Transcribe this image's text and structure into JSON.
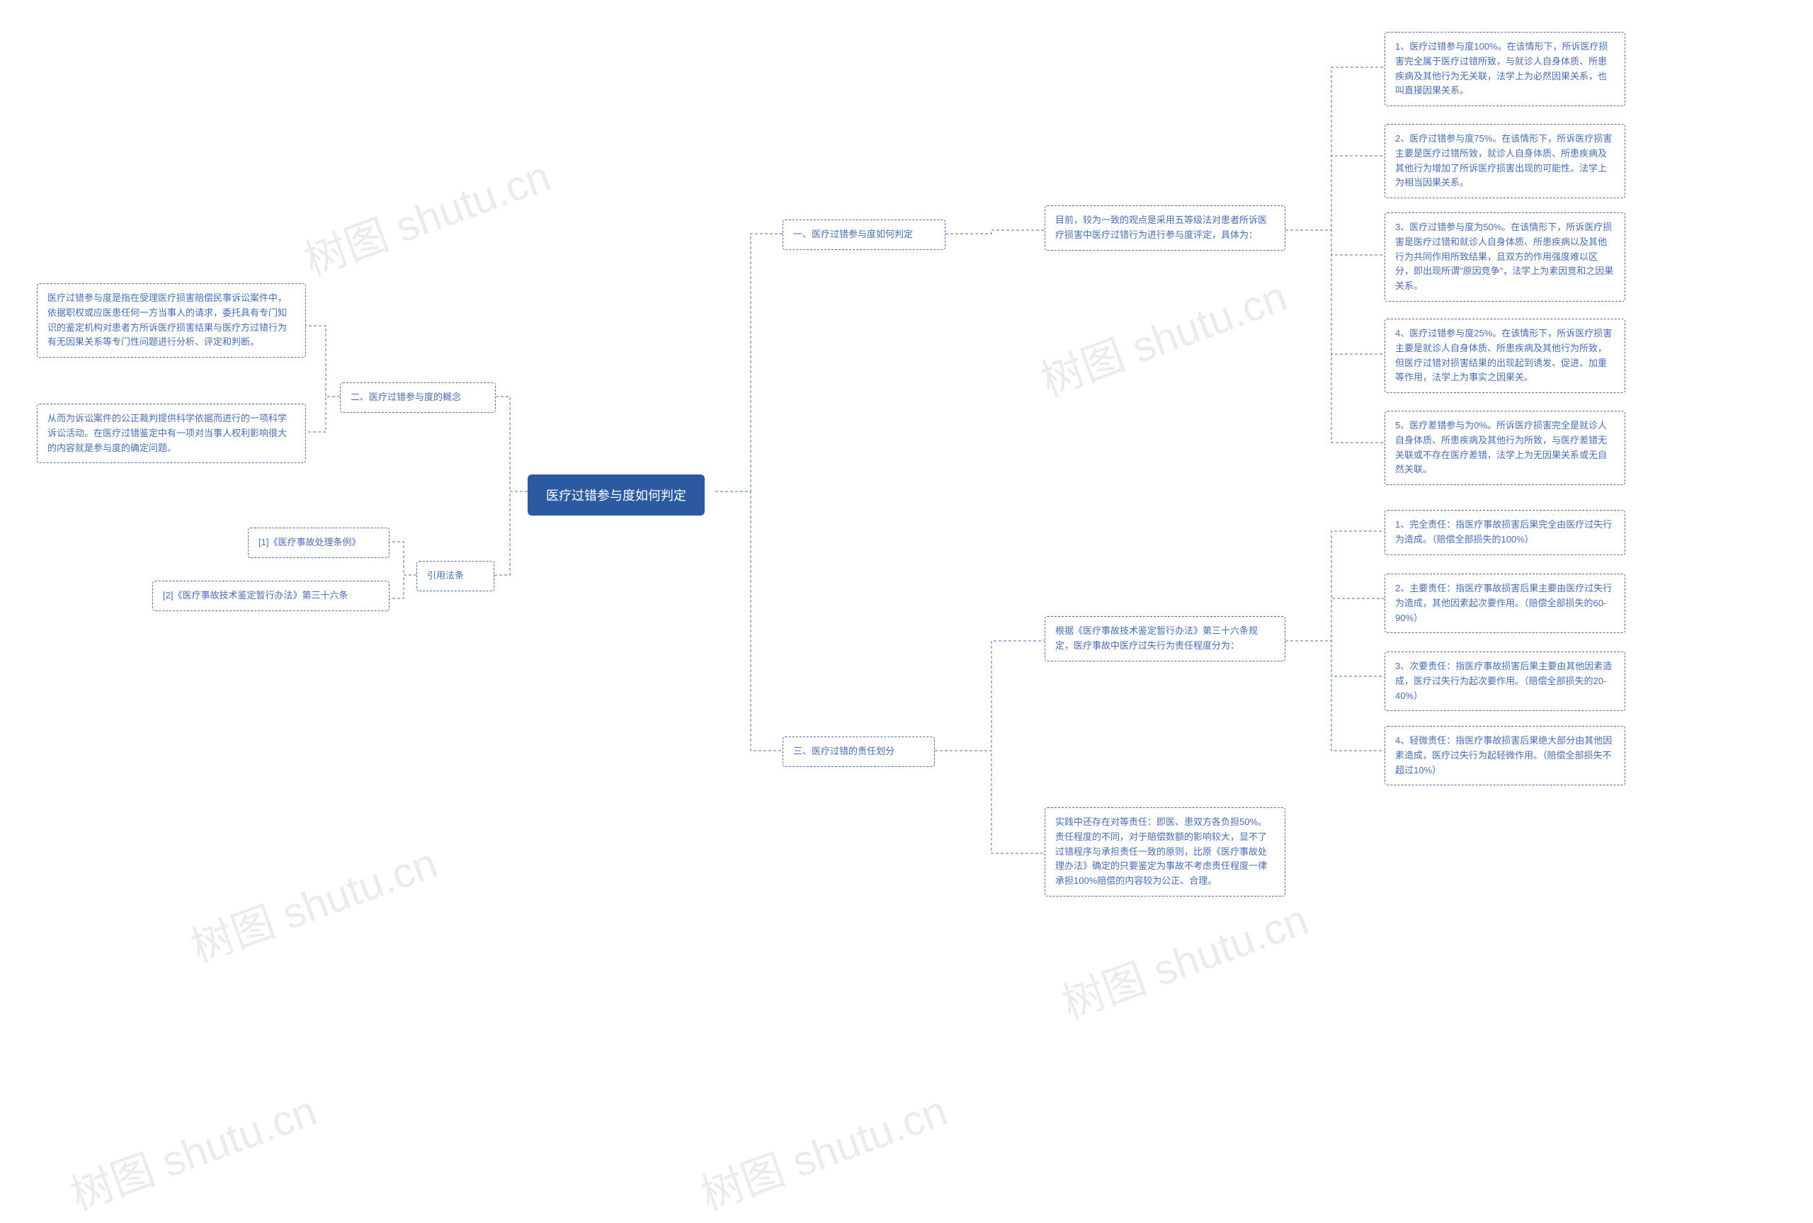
{
  "watermark": "树图 shutu.cn",
  "root": {
    "label": "医疗过错参与度如何判定"
  },
  "left": {
    "section2": {
      "label": "二、医疗过错参与度的概念",
      "items": [
        "医疗过错参与度是指在受理医疗损害赔偿民事诉讼案件中，依据职权或应医患任何一方当事人的请求，委托具有专门知识的鉴定机构对患者方所诉医疗损害结果与医疗方过错行为有无因果关系等专门性问题进行分析、评定和判断。",
        "从而为诉讼案件的公正裁判提供科学依据而进行的一项科学诉讼活动。在医疗过错鉴定中有一项对当事人权利影响很大的内容就是参与度的确定问题。"
      ]
    },
    "citations": {
      "label": "引用法条",
      "items": [
        "[1]《医疗事故处理条例》",
        "[2]《医疗事故技术鉴定暂行办法》第三十六条"
      ]
    }
  },
  "right": {
    "section1": {
      "label": "一、医疗过错参与度如何判定",
      "intro": "目前，较为一致的观点是采用五等级法对患者所诉医疗损害中医疗过错行为进行参与度评定，具体为：",
      "items": [
        "1、医疗过错参与度100%。在该情形下，所诉医疗损害完全属于医疗过错所致，与就诊人自身体质、所患疾病及其他行为无关联，法学上为必然因果关系，也叫直接因果关系。",
        "2、医疗过错参与度75%。在该情形下，所诉医疗损害主要是医疗过错所致，就诊人自身体质、所患疾病及其他行为增加了所诉医疗损害出现的可能性。法学上为相当因果关系。",
        "3、医疗过错参与度为50%。在该情形下，所诉医疗损害是医疗过错和就诊人自身体质、所患疾病以及其他行为共同作用所致结果，且双方的作用强度难以区分，即出现所谓\"原因竞争\"，法学上为素因竞和之因果关系。",
        "4、医疗过错参与度25%。在该情形下，所诉医疗损害主要是就诊人自身体质、所患疾病及其他行为所致，但医疗过错对损害结果的出现起到诱发、促进、加重等作用，法学上为事实之因果关。",
        "5、医疗差错参与为0%。所诉医疗损害完全是就诊人自身体质、所患疾病及其他行为所致，与医疗差错无关联或不存在医疗差错，法学上为无因果关系或无自然关联。"
      ]
    },
    "section3": {
      "label": "三、医疗过错的责任划分",
      "intro": "根据《医疗事故技术鉴定暂行办法》第三十六条规定，医疗事故中医疗过失行为责任程度分为：",
      "items": [
        "1、完全责任：指医疗事故损害后果完全由医疗过失行为造成。（赔偿全部损失的100%）",
        "2、主要责任：指医疗事故损害后果主要由医疗过失行为造成，其他因素起次要作用。（赔偿全部损失的60-90%）",
        "3、次要责任：指医疗事故损害后果主要由其他因素造成，医疗过失行为起次要作用。（赔偿全部损失的20-40%）",
        "4、轻微责任：指医疗事故损害后果绝大部分由其他因素造成，医疗过失行为起轻微作用。（赔偿全部损失不超过10%）"
      ],
      "note": "实践中还存在对等责任：即医、患双方各负担50%。责任程度的不同，对于赔偿数额的影响较大，显不了过错程序与承担责任一致的原则，比原《医疗事故处理办法》确定的只要鉴定为事故不考虑责任程度一律承担100%赔偿的内容较为公正、合理。"
    }
  }
}
